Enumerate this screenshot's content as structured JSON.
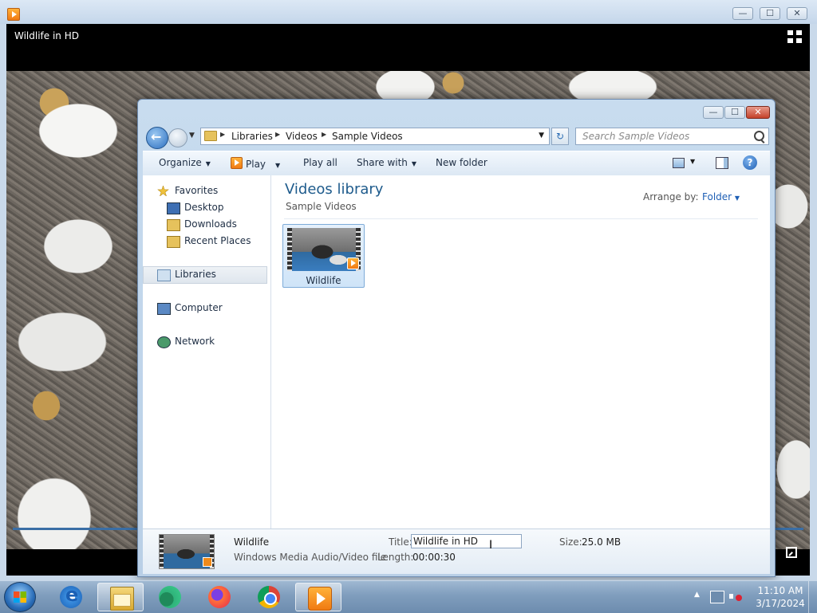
{
  "media_player": {
    "video_title": "Wildlife in HD"
  },
  "explorer": {
    "breadcrumbs": [
      "Libraries",
      "Videos",
      "Sample Videos"
    ],
    "search_placeholder": "Search Sample Videos",
    "toolbar": {
      "organize": "Organize",
      "play": "Play",
      "play_all": "Play all",
      "share_with": "Share with",
      "new_folder": "New folder"
    },
    "nav_pane": {
      "favorites": "Favorites",
      "desktop": "Desktop",
      "downloads": "Downloads",
      "recent_places": "Recent Places",
      "libraries": "Libraries",
      "computer": "Computer",
      "network": "Network"
    },
    "content": {
      "title": "Videos library",
      "subtitle": "Sample Videos",
      "arrange_label": "Arrange by:",
      "arrange_value": "Folder",
      "items": [
        {
          "label": "Wildlife"
        }
      ]
    },
    "details": {
      "name": "Wildlife",
      "type": "Windows Media Audio/Video file",
      "title_label": "Title:",
      "title_value": "Wildlife in HD",
      "length_label": "Length:",
      "length_value": "00:00:30",
      "size_label": "Size:",
      "size_value": "25.0 MB"
    }
  },
  "taskbar": {
    "apps": [
      "internet-explorer",
      "windows-explorer",
      "edge",
      "firefox",
      "chrome",
      "windows-media-player"
    ],
    "active_app": "windows-explorer",
    "clock_time": "11:10 AM",
    "clock_date": "3/17/2024"
  },
  "icons": {
    "minimize": "—",
    "maximize": "☐",
    "close": "✕",
    "help": "?",
    "refresh": "↻",
    "chevron_down": "▼",
    "chevron_right": "▶",
    "tray_up": "▲",
    "text_cursor": "I"
  },
  "colors": {
    "accent_blue": "#1e5fb5",
    "library_title": "#1e5b8c",
    "wmp_orange": "#f07a12"
  }
}
